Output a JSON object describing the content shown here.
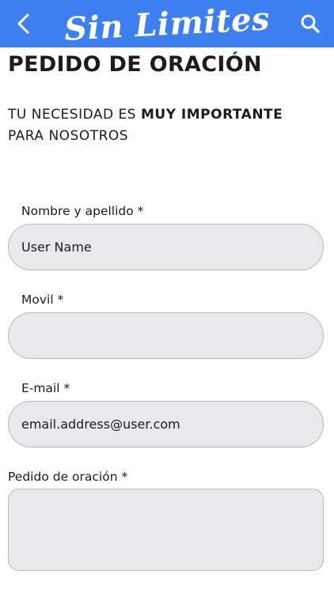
{
  "header": {
    "brand": "Sin Limites",
    "back_icon": "chevron-left-icon",
    "search_icon": "search-icon",
    "color": "#3d7ef0"
  },
  "page": {
    "title": "PEDIDO DE ORACIÓN",
    "subtitle_pre": "TU NECESIDAD ES ",
    "subtitle_bold": "MUY IMPORTANTE",
    "subtitle_post": " PARA NOSOTROS"
  },
  "form": {
    "name_label": "Nombre y apellido *",
    "name_value": "User Name",
    "mobile_label": "Movil *",
    "mobile_value": "",
    "email_label": "E-mail *",
    "email_value": "email.address@user.com",
    "request_label": "Pedido de oración *",
    "request_value": ""
  }
}
